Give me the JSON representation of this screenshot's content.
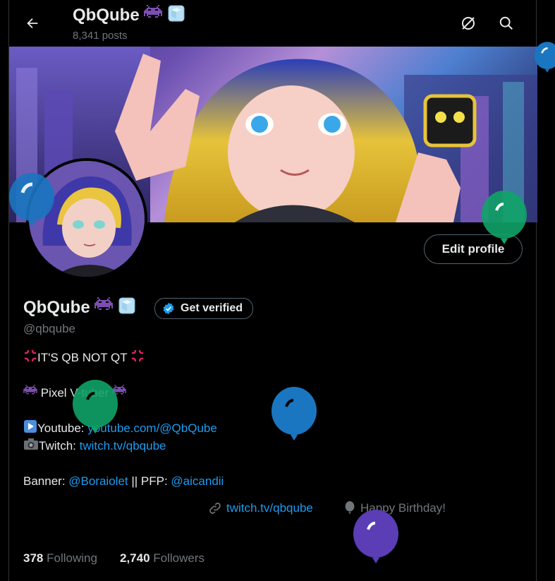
{
  "header": {
    "title": "QbQube",
    "posts_count": "8,341 posts"
  },
  "profile": {
    "display_name": "QbQube",
    "handle": "@qbqube",
    "edit_profile_label": "Edit profile",
    "get_verified_label": "Get verified",
    "bio": {
      "line1": "IT'S QB NOT QT",
      "line2": "Pixel V-tuber",
      "youtube_prefix": "Youtube: ",
      "youtube_link": "youtube.com/@QbQube",
      "twitch_prefix": "Twitch: ",
      "twitch_link": "twitch.tv/qbqube",
      "banner_prefix": "Banner: ",
      "banner_link": "@Boraiolet",
      "pfp_sep": " || PFP: ",
      "pfp_link": "@aicandii"
    },
    "website_link": "twitch.tv/qbqube",
    "birthday": "Happy Birthday!",
    "following_count": "378",
    "following_label": "Following",
    "followers_count": "2,740",
    "followers_label": "Followers"
  },
  "colors": {
    "accent": "#1d9bf0",
    "muted": "#71767b",
    "balloon_blue": "#1a76c0",
    "balloon_green": "#11a368",
    "balloon_purple": "#5b3db5"
  },
  "icons": [
    "back-arrow-icon",
    "refresh-icon",
    "search-icon",
    "verified-badge-icon",
    "link-icon",
    "balloon-icon",
    "anger-icon",
    "alien-monster-icon",
    "ice-cube-icon",
    "play-icon",
    "camera-icon"
  ]
}
